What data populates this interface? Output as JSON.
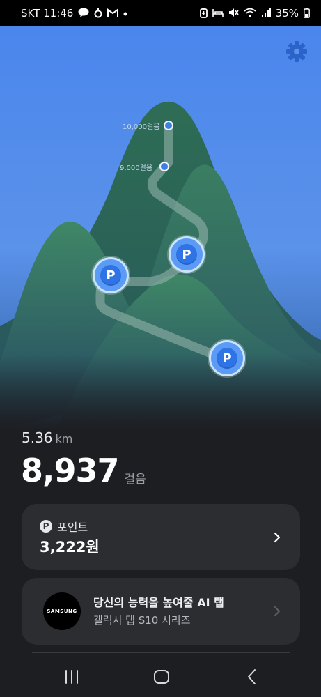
{
  "status_bar": {
    "time": "SKT 11:46",
    "battery": "35%",
    "left_icons": [
      "talk-icon",
      "app-icon",
      "gmail-icon",
      "dot-icon"
    ],
    "right_icons": [
      "battery-saver-icon",
      "sleep-icon",
      "mute-icon",
      "wifi-icon",
      "signal-icon",
      "battery-icon"
    ]
  },
  "milestones": [
    {
      "label": "10,000걸음"
    },
    {
      "label": "9,000걸음"
    }
  ],
  "point_badges": [
    "P",
    "P",
    "P"
  ],
  "stats": {
    "distance_value": "5.36",
    "distance_unit": "km",
    "steps_value": "8,937",
    "steps_unit": "걸음"
  },
  "points_card": {
    "icon_letter": "P",
    "label": "포인트",
    "value": "3,222원"
  },
  "ad_card": {
    "logo_text": "SAMSUNG",
    "title": "당신의 능력을 높여줄 AI 탭",
    "subtitle": "갤럭시 탭 S10 시리즈"
  },
  "colors": {
    "sky_top": "#4c86ea",
    "mountain": "#2d6b55",
    "accent_blue": "#2f74e6",
    "background": "#1d1e22",
    "card": "#2c2d31"
  }
}
